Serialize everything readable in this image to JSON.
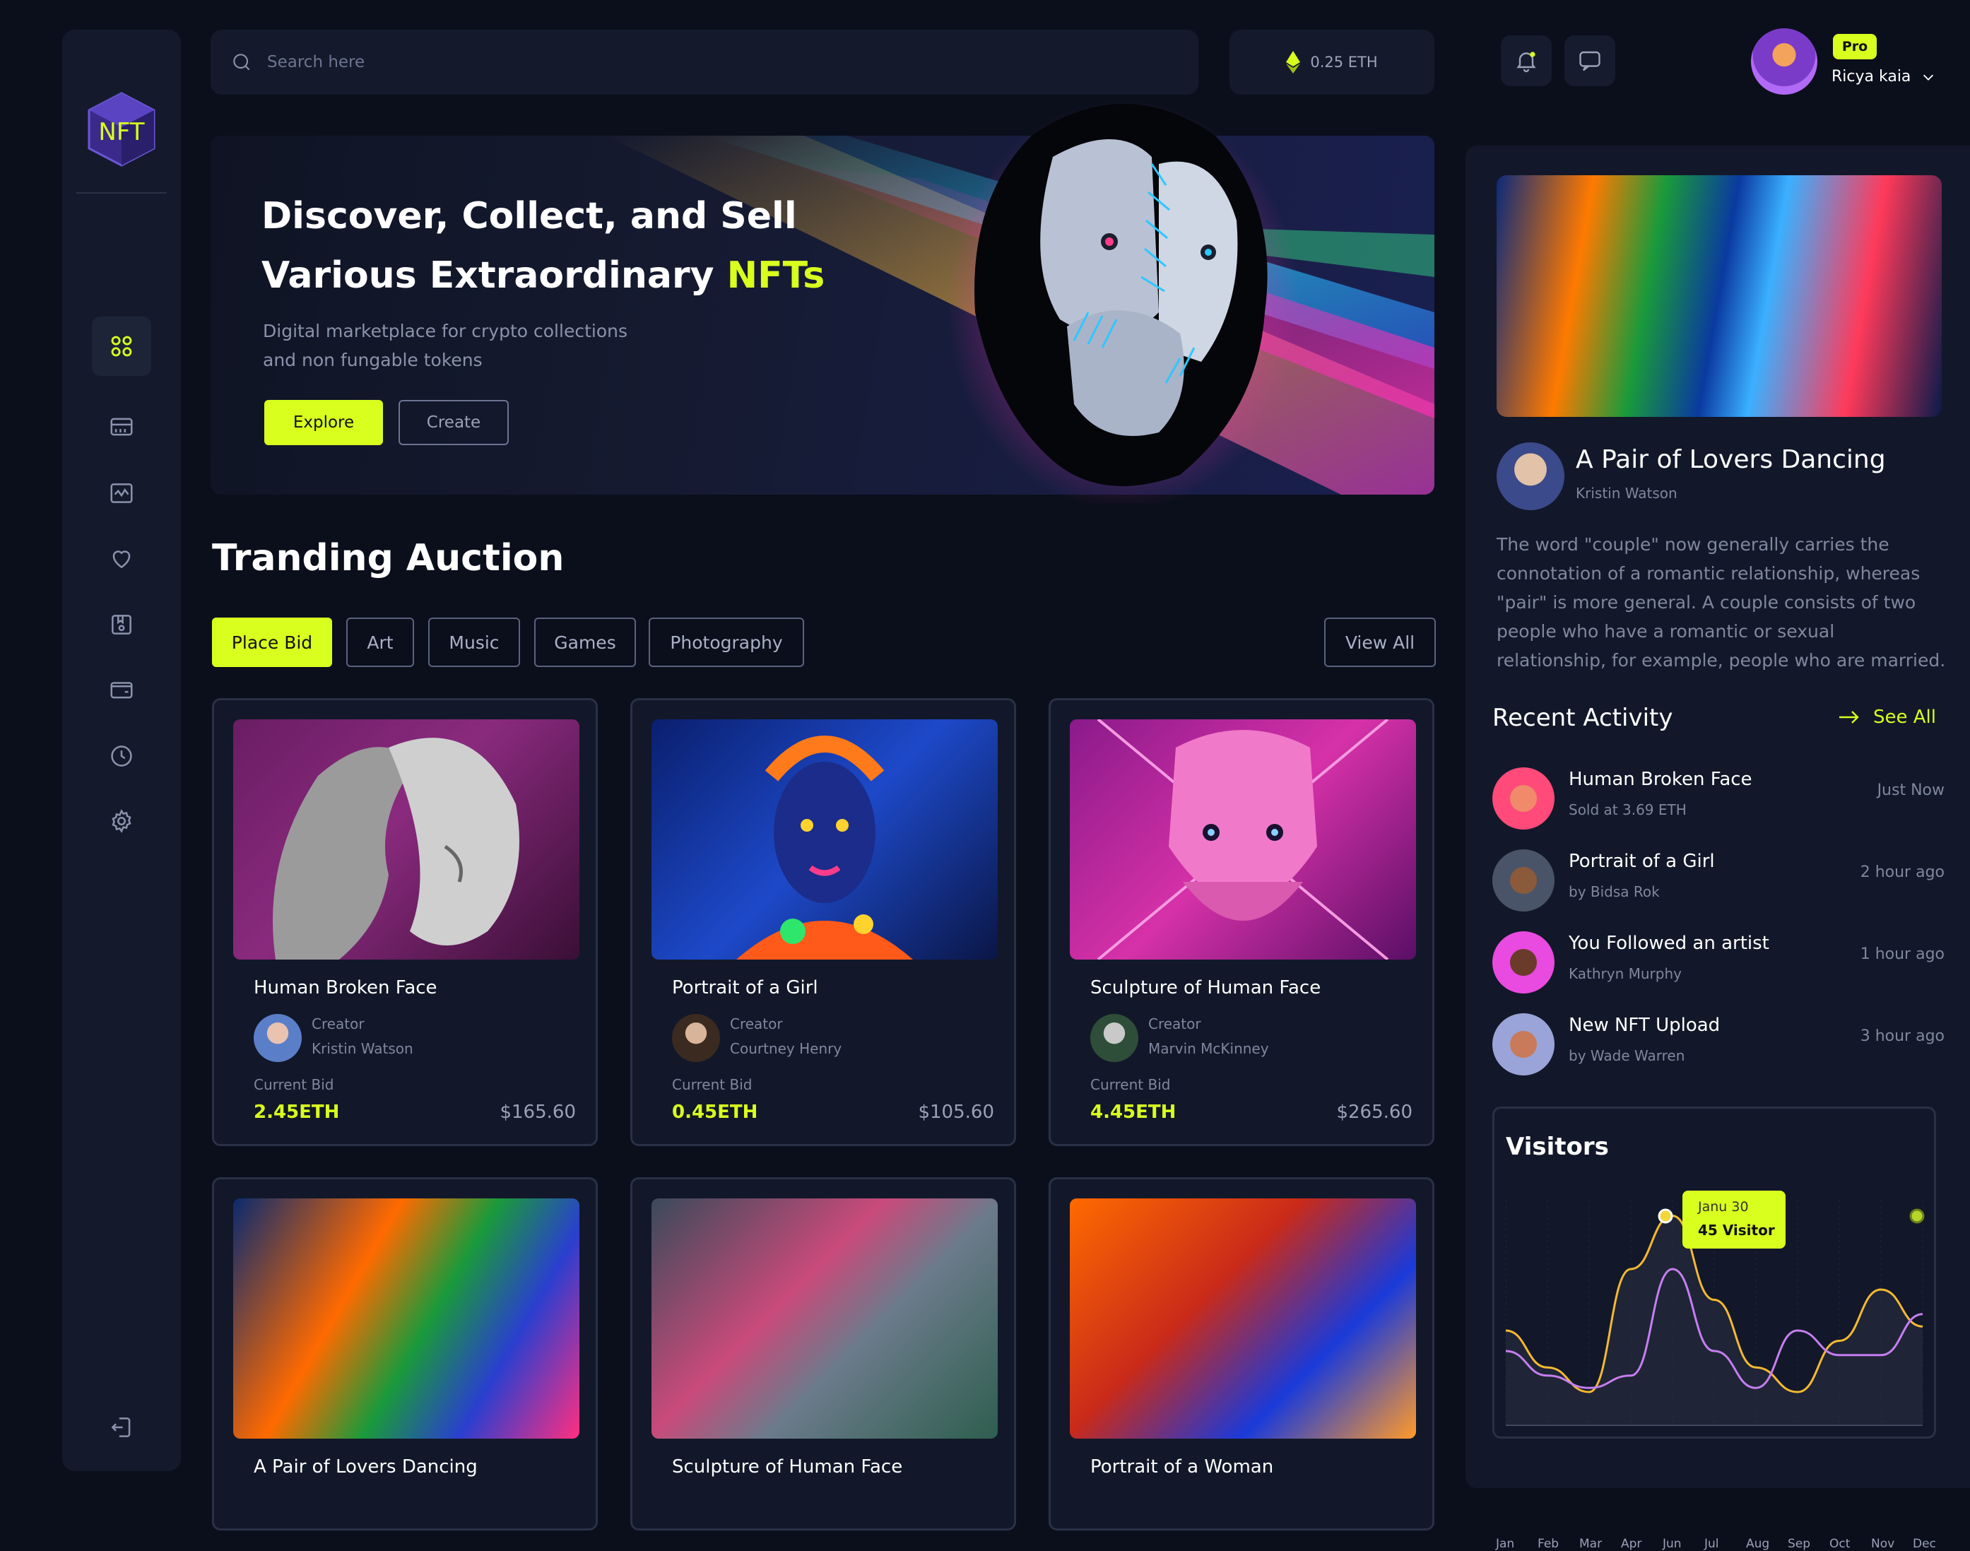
{
  "brand": {
    "logo_text": "NFT"
  },
  "search": {
    "placeholder": "Search here"
  },
  "wallet": {
    "balance": "0.25 ETH"
  },
  "user": {
    "badge": "Pro",
    "name": "Ricya kaia"
  },
  "sidebar": {
    "icons": [
      "grid-icon",
      "marketplace-icon",
      "activity-icon",
      "heart-icon",
      "collection-icon",
      "wallet-icon",
      "clock-icon",
      "settings-icon"
    ],
    "logout_icon": "logout-icon"
  },
  "hero": {
    "title_line1": "Discover, Collect, and Sell",
    "title_line2": "Various Extraordinary ",
    "title_highlight": "NFTs",
    "subtitle": "Digital marketplace for crypto collections and non fungable tokens",
    "explore_label": "Explore",
    "create_label": "Create"
  },
  "auction": {
    "title": "Tranding Auction",
    "filters": [
      "Place Bid",
      "Art",
      "Music",
      "Games",
      "Photography"
    ],
    "view_all": "View All",
    "creator_label": "Creator",
    "current_bid_label": "Current Bid",
    "cards": [
      {
        "title": "Human Broken Face",
        "creator": "Kristin Watson",
        "bid": "2.45ETH",
        "price": "$165.60"
      },
      {
        "title": "Portrait of a Girl",
        "creator": "Courtney Henry",
        "bid": "0.45ETH",
        "price": "$105.60"
      },
      {
        "title": "Sculpture of Human Face",
        "creator": "Marvin McKinney",
        "bid": "4.45ETH",
        "price": "$265.60"
      },
      {
        "title": "A Pair of Lovers Dancing",
        "creator": "",
        "bid": "",
        "price": ""
      },
      {
        "title": "Sculpture of Human Face",
        "creator": "",
        "bid": "",
        "price": ""
      },
      {
        "title": "Portrait of a Woman",
        "creator": "",
        "bid": "",
        "price": ""
      }
    ]
  },
  "featured": {
    "title": "A Pair of Lovers Dancing",
    "creator": "Kristin Watson",
    "description": "The word \"couple\" now generally carries the connotation of a romantic relationship, whereas \"pair\" is more general. A couple consists of two people who have a romantic or sexual relationship, for example, people who are married."
  },
  "activity": {
    "title": "Recent Activity",
    "see_all": "See All",
    "items": [
      {
        "title": "Human Broken Face",
        "sub": "Sold at 3.69 ETH",
        "time": "Just Now"
      },
      {
        "title": "Portrait of a Girl",
        "sub": "by Bidsa Rok",
        "time": "2 hour ago"
      },
      {
        "title": "You Followed an artist",
        "sub": "Kathryn Murphy",
        "time": "1 hour ago"
      },
      {
        "title": "New NFT Upload",
        "sub": "by Wade Warren",
        "time": "3 hour ago"
      }
    ]
  },
  "visitors": {
    "title": "Visitors",
    "tooltip_date": "Janu 30",
    "tooltip_value": "45 Visitor"
  },
  "chart_data": {
    "type": "line",
    "title": "Visitors",
    "categories": [
      "Jan",
      "Feb",
      "Mar",
      "Apr",
      "Jun",
      "Jul",
      "Aug",
      "Sep",
      "Oct",
      "Nov",
      "Dec"
    ],
    "series": [
      {
        "name": "",
        "color": "#f5b932",
        "values": [
          40,
          22,
          10,
          70,
          96,
          55,
          22,
          10,
          35,
          60,
          42
        ]
      },
      {
        "name": "",
        "color": "#c57ef0",
        "values": [
          30,
          18,
          12,
          18,
          70,
          30,
          12,
          40,
          28,
          28,
          48
        ]
      }
    ],
    "ylim": [
      0,
      100
    ],
    "highlight": {
      "series": 0,
      "index": 4,
      "label": "45 Visitor"
    }
  },
  "colors": {
    "accent": "#d9ff1e",
    "bg": "#0b0f1c",
    "panel": "#121829"
  }
}
